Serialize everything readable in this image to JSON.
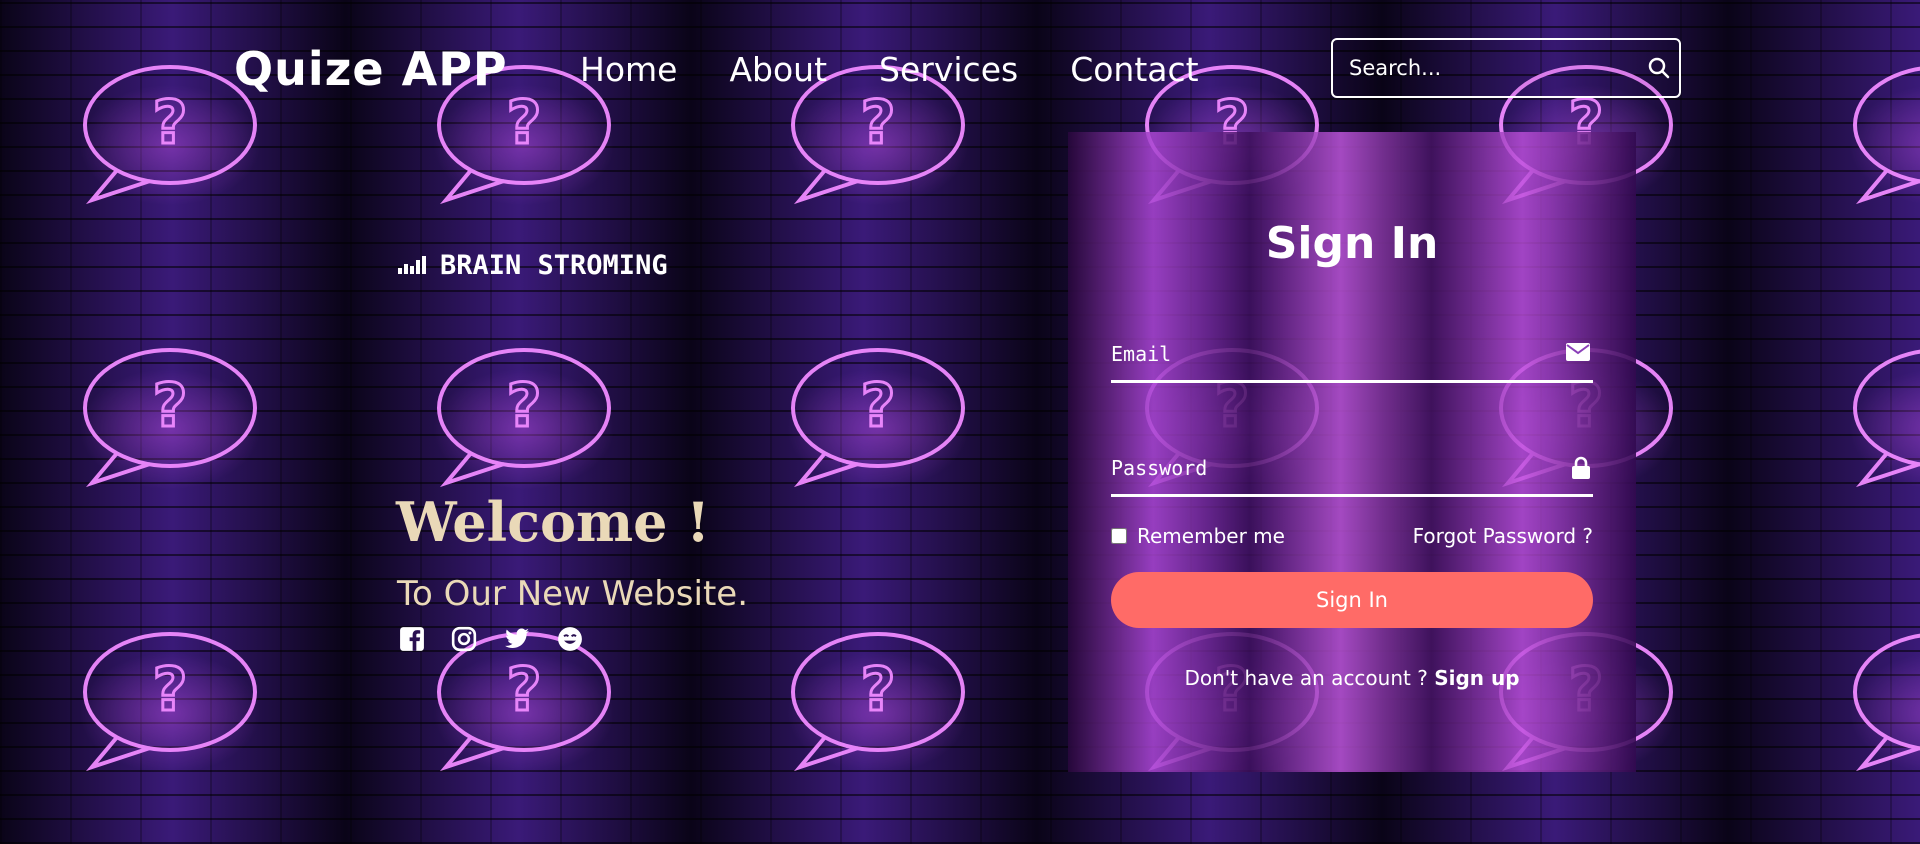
{
  "header": {
    "logo": "Quize APP",
    "nav": [
      "Home",
      "About",
      "Services",
      "Contact"
    ],
    "search_placeholder": "Search..."
  },
  "hero": {
    "brand_icon": "soundbars-icon",
    "brand": "BRAIN STROMING",
    "welcome": "Welcome !",
    "subtitle": "To Our New Website.",
    "social_icons": [
      "facebook-icon",
      "instagram-icon",
      "twitter-icon",
      "smile-icon"
    ]
  },
  "signin": {
    "title": "Sign In",
    "email_placeholder": "Email",
    "email_icon": "mail-icon",
    "password_placeholder": "Password",
    "password_icon": "lock-icon",
    "remember": "Remember me",
    "forgot": "Forgot Password ?",
    "button": "Sign In",
    "no_account": "Don't have an account ?",
    "signup_link": "Sign up"
  },
  "colors": {
    "accent_button": "#ff6b67",
    "hero_text": "#ead9b8",
    "neon": "#e36cff"
  }
}
